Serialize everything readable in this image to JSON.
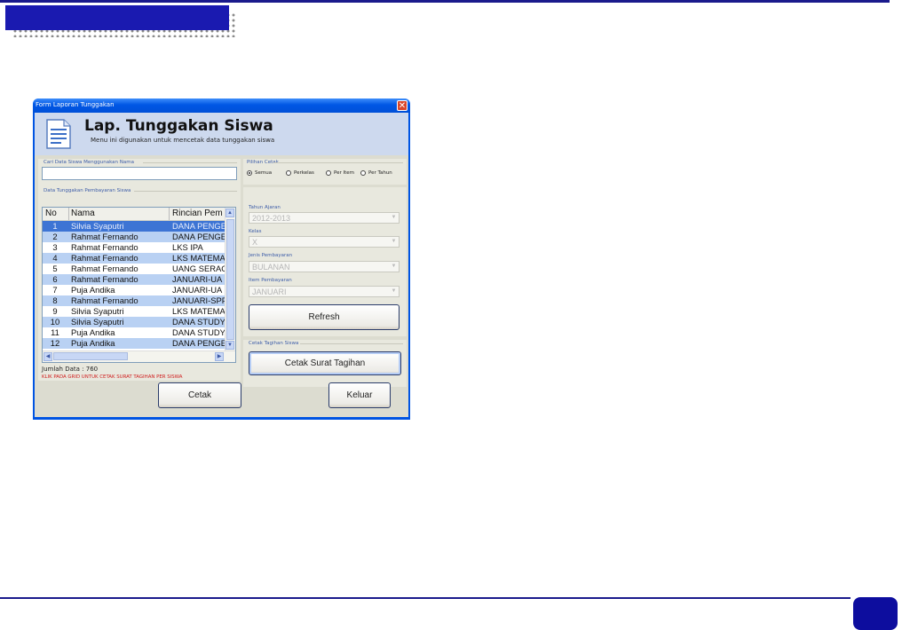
{
  "window": {
    "title": "Form Laporan Tunggakan",
    "close_glyph": "✕"
  },
  "header": {
    "title": "Lap. Tunggakan Siswa",
    "subtitle": "Menu ini digunakan untuk mencetak data tunggakan siswa",
    "icon": "document-icon"
  },
  "search": {
    "label": "Cari Data Siswa Menggunakan Nama",
    "value": ""
  },
  "grid": {
    "label": "Data Tunggakan Pembayaran Siswa",
    "columns": [
      "No",
      "Nama",
      "Rincian Pem"
    ],
    "rows": [
      {
        "no": "1",
        "nama": "Silvia Syaputri",
        "rincian": "DANA PENGE"
      },
      {
        "no": "2",
        "nama": "Rahmat Fernando",
        "rincian": "DANA PENGE"
      },
      {
        "no": "3",
        "nama": "Rahmat Fernando",
        "rincian": "LKS IPA"
      },
      {
        "no": "4",
        "nama": "Rahmat Fernando",
        "rincian": "LKS MATEMA"
      },
      {
        "no": "5",
        "nama": "Rahmat Fernando",
        "rincian": "UANG SERAG"
      },
      {
        "no": "6",
        "nama": "Rahmat Fernando",
        "rincian": "JANUARI-UA"
      },
      {
        "no": "7",
        "nama": "Puja Andika",
        "rincian": "JANUARI-UA"
      },
      {
        "no": "8",
        "nama": "Rahmat Fernando",
        "rincian": "JANUARI-SPP"
      },
      {
        "no": "9",
        "nama": "Silvia Syaputri",
        "rincian": "LKS MATEMA"
      },
      {
        "no": "10",
        "nama": "Silvia Syaputri",
        "rincian": "DANA STUDY"
      },
      {
        "no": "11",
        "nama": "Puja Andika",
        "rincian": "DANA STUDY"
      },
      {
        "no": "12",
        "nama": "Puja Andika",
        "rincian": "DANA PENGE"
      }
    ],
    "jumlah": "Jumlah Data : 760",
    "hint": "KLIK PADA GRID UNTUK CETAK SURAT TAGIHAN PER SISWA"
  },
  "pilihan": {
    "label": "Pilihan Cetak",
    "options": [
      "Semua",
      "Perkelas",
      "Per Item",
      "Per Tahun"
    ],
    "selected": "Semua"
  },
  "filters": {
    "tahun_label": "Tahun Ajaran",
    "tahun_value": "2012-2013",
    "kelas_label": "Kelas",
    "kelas_value": "X",
    "jenis_label": "Jenis Pembayaran",
    "jenis_value": "BULANAN",
    "item_label": "Item Pembayaran",
    "item_value": "JANUARI"
  },
  "buttons": {
    "refresh": "Refresh",
    "cetak_tagihan_group": "Cetak Tagihan Siswa",
    "cetak_surat": "Cetak Surat Tagihan",
    "cetak": "Cetak",
    "keluar": "Keluar"
  },
  "colors": {
    "accent": "#1a1ab0",
    "row_alt": "#b9d1f3",
    "row_selected": "#3d74d4"
  }
}
